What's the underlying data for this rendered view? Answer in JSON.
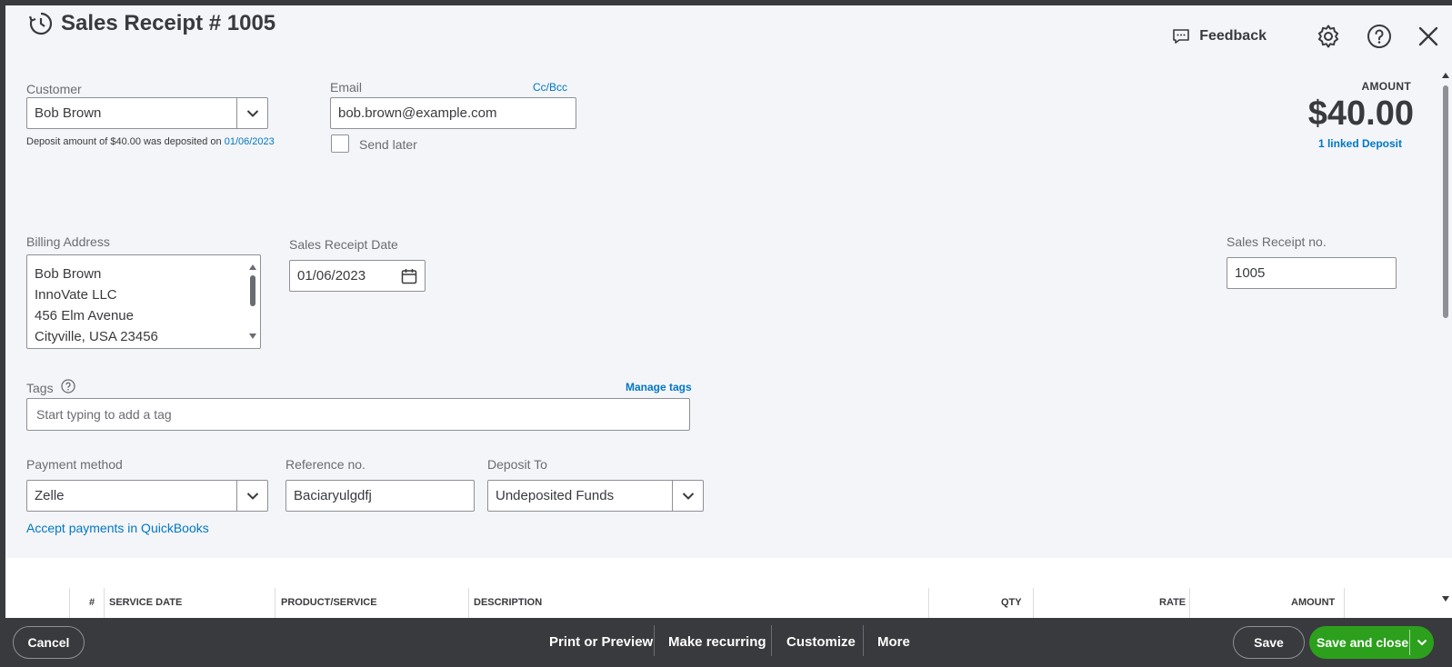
{
  "header": {
    "title": "Sales Receipt # 1005",
    "feedback_label": "Feedback"
  },
  "customer": {
    "label": "Customer",
    "value": "Bob Brown",
    "deposit_note_prefix": "Deposit amount of $40.00 was deposited on",
    "deposit_date": "01/06/2023"
  },
  "email": {
    "label": "Email",
    "ccbcc": "Cc/Bcc",
    "value": "bob.brown@example.com",
    "send_later_label": "Send later"
  },
  "amount": {
    "label": "AMOUNT",
    "value": "$40.00",
    "linked_deposit": "1 linked Deposit"
  },
  "billing": {
    "label": "Billing Address",
    "lines": [
      "Bob Brown",
      "InnoVate LLC",
      "456 Elm Avenue",
      "Cityville, USA  23456"
    ]
  },
  "receipt_date": {
    "label": "Sales Receipt Date",
    "value": "01/06/2023"
  },
  "receipt_no": {
    "label": "Sales Receipt no.",
    "value": "1005"
  },
  "tags": {
    "label": "Tags",
    "manage": "Manage tags",
    "placeholder": "Start typing to add a tag"
  },
  "payment": {
    "method_label": "Payment method",
    "method_value": "Zelle",
    "ref_label": "Reference no.",
    "ref_value": "Baciaryulgdfj",
    "deposit_label": "Deposit To",
    "deposit_value": "Undeposited Funds",
    "accept_link": "Accept payments in QuickBooks"
  },
  "table": {
    "columns": [
      "#",
      "SERVICE DATE",
      "PRODUCT/SERVICE",
      "DESCRIPTION",
      "QTY",
      "RATE",
      "AMOUNT"
    ]
  },
  "footer": {
    "cancel": "Cancel",
    "print": "Print or Preview",
    "recurring": "Make recurring",
    "customize": "Customize",
    "more": "More",
    "save": "Save",
    "save_close": "Save and close"
  },
  "colors": {
    "link": "#0077c5",
    "primary": "#2ca01c",
    "footer_bg": "#393a3d"
  }
}
